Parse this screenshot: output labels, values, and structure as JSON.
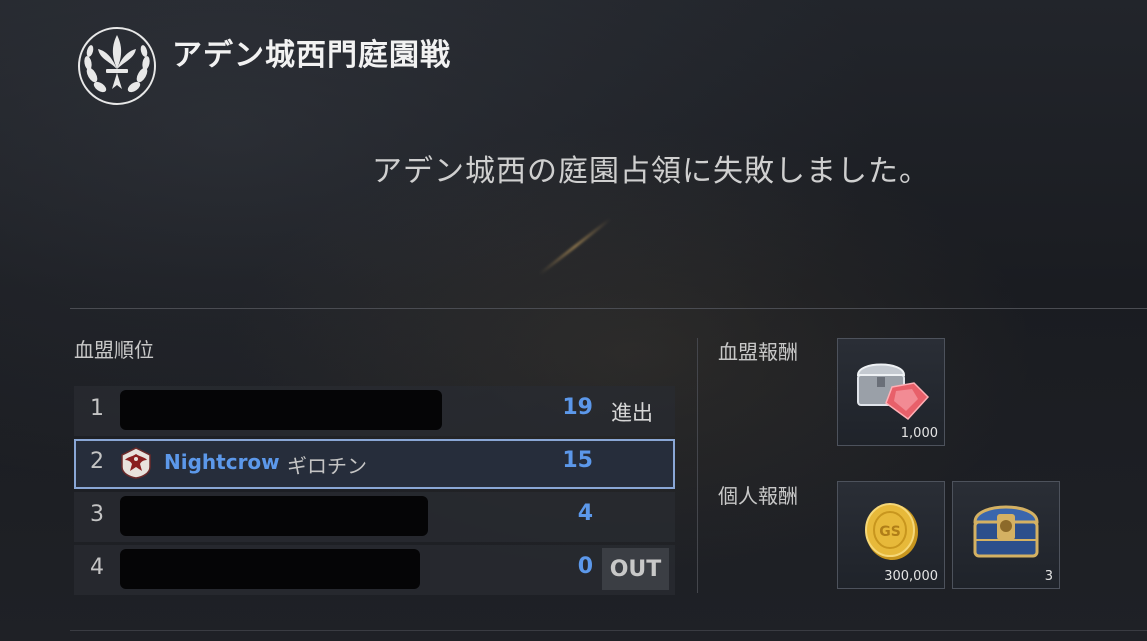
{
  "header": {
    "title": "アデン城西門庭園戦",
    "emblem_icon": "fleur-de-lis-laurel-icon"
  },
  "result_message": "アデン城西の庭園占領に失敗しました。",
  "rankings": {
    "label": "血盟順位",
    "rows": [
      {
        "rank": "1",
        "score": "19",
        "status": "進出",
        "redacted": true
      },
      {
        "rank": "2",
        "guild": "Nightcrow",
        "server": "ギロチン",
        "score": "15",
        "status": "",
        "redacted": false,
        "guild_icon": "eagle-crest-icon"
      },
      {
        "rank": "3",
        "score": "4",
        "status": "",
        "redacted": true
      },
      {
        "rank": "4",
        "score": "0",
        "status": "OUT",
        "redacted": true
      }
    ]
  },
  "rewards": {
    "clan_label": "血盟報酬",
    "personal_label": "個人報酬",
    "clan_items": [
      {
        "icon": "treasure-chest-red-gem-icon",
        "qty": "1,000"
      }
    ],
    "personal_items": [
      {
        "icon": "gold-coin-icon",
        "qty": "300,000"
      },
      {
        "icon": "ornate-blue-chest-icon",
        "qty": "3"
      }
    ]
  },
  "colors": {
    "accent_blue": "#5c98ea",
    "highlight_border": "#8aa7d6"
  }
}
